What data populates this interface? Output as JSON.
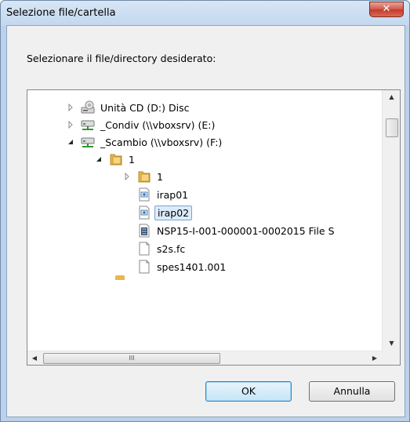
{
  "window": {
    "title": "Selezione file/cartella",
    "close_label": "✕"
  },
  "prompt": "Selezionare il file/directory desiderato:",
  "tree": {
    "nodes": [
      {
        "label": "Unità CD (D:) Disc",
        "icon": "cd-drive-icon",
        "expander": "collapsed"
      },
      {
        "label": "_Condiv (\\\\vboxsrv) (E:)",
        "icon": "network-drive-icon",
        "expander": "collapsed"
      },
      {
        "label": "_Scambio (\\\\vboxsrv) (F:)",
        "icon": "network-drive-icon",
        "expander": "expanded"
      },
      {
        "label": "1",
        "icon": "folder-icon",
        "expander": "expanded"
      },
      {
        "label": "1",
        "icon": "folder-icon",
        "expander": "collapsed"
      },
      {
        "label": "irap01",
        "icon": "settings-file-icon",
        "expander": "none"
      },
      {
        "label": "irap02",
        "icon": "settings-file-icon",
        "expander": "none",
        "selected": true
      },
      {
        "label": "NSP15-I-001-000001-0002015 File S",
        "icon": "binary-file-icon",
        "expander": "none"
      },
      {
        "label": "s2s.fc",
        "icon": "blank-file-icon",
        "expander": "none"
      },
      {
        "label": "spes1401.001",
        "icon": "blank-file-icon",
        "expander": "none"
      }
    ]
  },
  "scrollbar": {
    "up": "▲",
    "down": "▼",
    "left": "◀",
    "right": "▶",
    "grip": "III"
  },
  "buttons": {
    "ok": "OK",
    "cancel": "Annulla"
  },
  "colors": {
    "selection_bg": "#dcebfc",
    "selection_border": "#7da2ce",
    "close_button": "#c4392e",
    "folder": "#e8b84a"
  }
}
